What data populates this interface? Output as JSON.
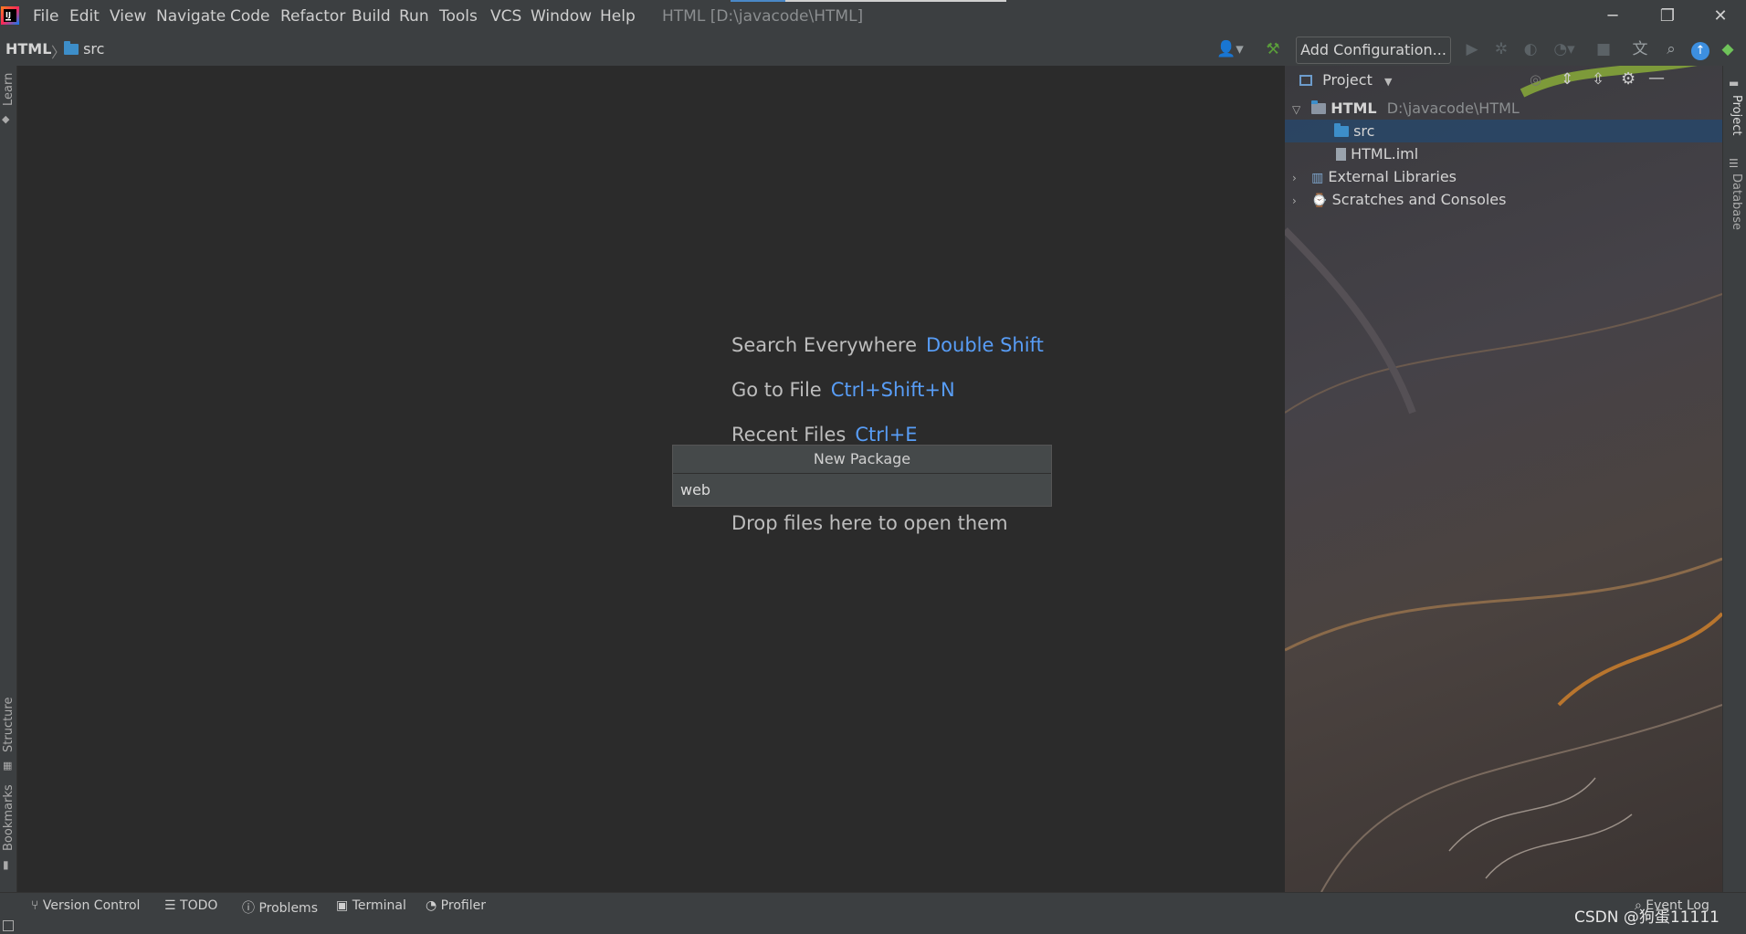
{
  "titlebar": {
    "menus": [
      "File",
      "Edit",
      "View",
      "Navigate",
      "Code",
      "Refactor",
      "Build",
      "Run",
      "Tools",
      "VCS",
      "Window",
      "Help"
    ],
    "title": "HTML [D:\\javacode\\HTML]"
  },
  "navbar": {
    "crumbs": [
      "HTML",
      "src"
    ],
    "add_config": "Add Configuration..."
  },
  "left_strip": {
    "learn": "Learn",
    "structure": "Structure",
    "bookmarks": "Bookmarks"
  },
  "right_strip": {
    "project": "Project",
    "database": "Database"
  },
  "editor": {
    "hints": [
      {
        "label": "Search Everywhere",
        "key": "Double Shift"
      },
      {
        "label": "Go to File",
        "key": "Ctrl+Shift+N"
      },
      {
        "label": "Recent Files",
        "key": "Ctrl+E"
      }
    ],
    "drop": "Drop files here to open them"
  },
  "popup": {
    "title": "New Package",
    "value": "web"
  },
  "project_panel": {
    "title": "Project",
    "tree": [
      {
        "label": "HTML",
        "path": "D:\\javacode\\HTML"
      },
      {
        "label": "src"
      },
      {
        "label": "HTML.iml"
      },
      {
        "label": "External Libraries"
      },
      {
        "label": "Scratches and Consoles"
      }
    ]
  },
  "bottom_tabs": [
    "Version Control",
    "TODO",
    "Problems",
    "Terminal",
    "Profiler"
  ],
  "event_log": "Event Log",
  "watermark": "CSDN @狗蛋11111",
  "colors": {
    "accent": "#589df6",
    "selection": "#2d4a6b",
    "folder": "#3d8ec9"
  }
}
